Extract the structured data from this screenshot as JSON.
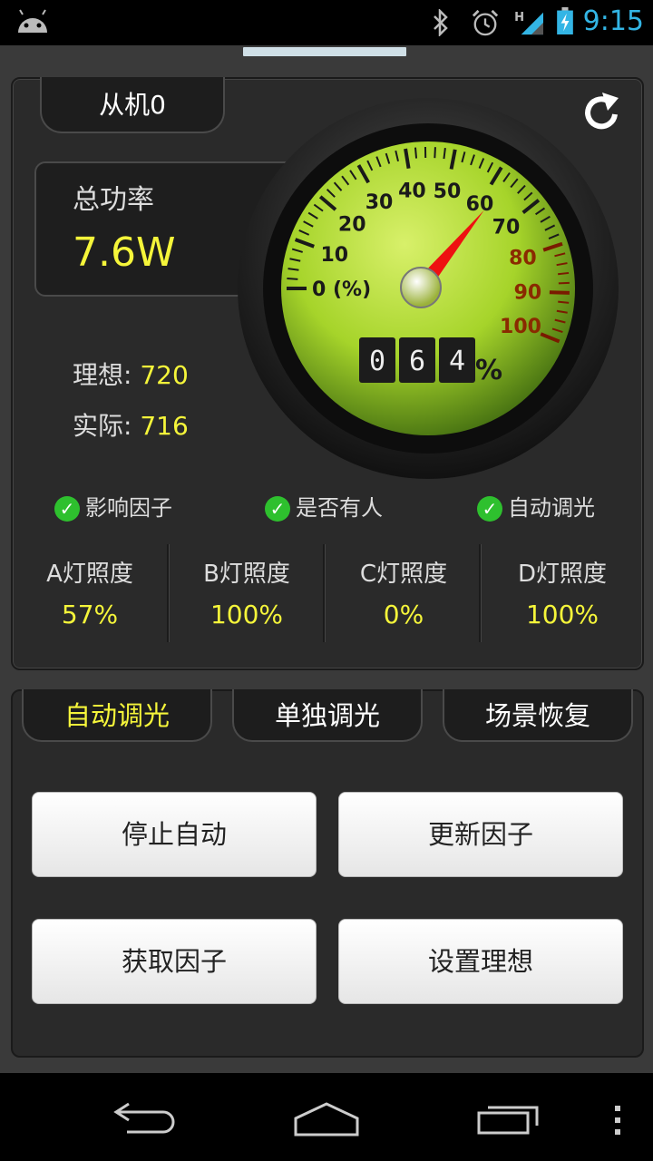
{
  "status_bar": {
    "time": "9:15",
    "icons": [
      "android-icon",
      "bluetooth-icon",
      "alarm-icon",
      "signal-h-icon",
      "battery-charging-icon"
    ]
  },
  "header": {
    "slave_tab": "从机0",
    "refresh_icon": "refresh-icon"
  },
  "power": {
    "label": "总功率",
    "value": "7.6W"
  },
  "ideal_actual": {
    "ideal_label": "理想: ",
    "ideal_value": "720",
    "actual_label": "实际: ",
    "actual_value": "716"
  },
  "gauge": {
    "ticks": [
      "0 (%)",
      "10",
      "20",
      "30",
      "40",
      "50",
      "60",
      "70",
      "80",
      "90",
      "100"
    ],
    "needle_value": 64,
    "digits": [
      "0",
      "6",
      "4"
    ],
    "unit": "%"
  },
  "checks": [
    {
      "label": "影响因子",
      "checked": true
    },
    {
      "label": "是否有人",
      "checked": true
    },
    {
      "label": "自动调光",
      "checked": true
    }
  ],
  "lux": [
    {
      "name": "A灯照度",
      "value": "57%"
    },
    {
      "name": "B灯照度",
      "value": "100%"
    },
    {
      "name": "C灯照度",
      "value": "0%"
    },
    {
      "name": "D灯照度",
      "value": "100%"
    }
  ],
  "tabs": [
    {
      "label": "自动调光",
      "active": true
    },
    {
      "label": "单独调光",
      "active": false
    },
    {
      "label": "场景恢复",
      "active": false
    }
  ],
  "buttons": {
    "stop_auto": "停止自动",
    "update_factor": "更新因子",
    "get_factor": "获取因子",
    "set_ideal": "设置理想"
  },
  "colors": {
    "accent_yellow": "#f5f53a",
    "status_blue": "#33b5e5",
    "check_green": "#2ec02e",
    "gauge_green": "#a6d42a"
  }
}
